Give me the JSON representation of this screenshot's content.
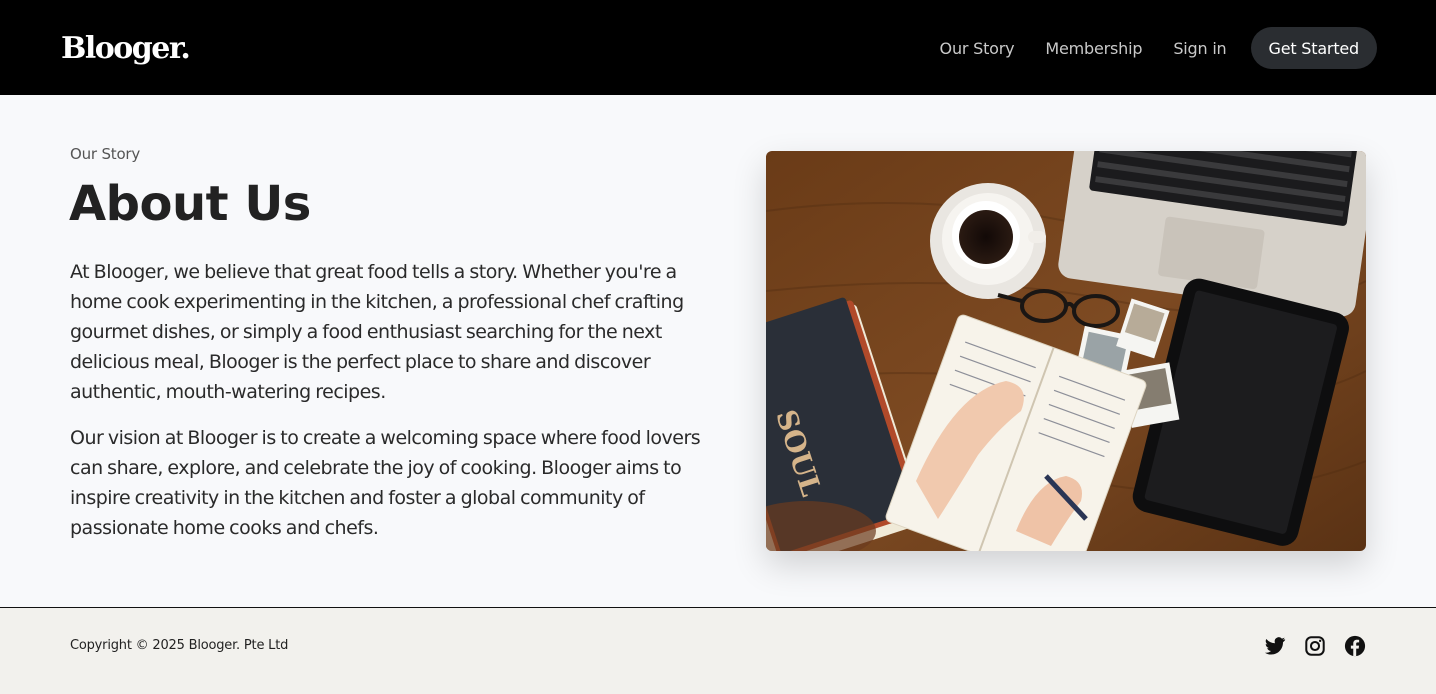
{
  "header": {
    "logo": "Blooger.",
    "nav": [
      "Our Story",
      "Membership",
      "Sign in"
    ],
    "cta": "Get Started"
  },
  "main": {
    "eyebrow": "Our Story",
    "title": "About Us",
    "paragraphs": [
      "At Blooger, we believe that great food tells a story. Whether you're a home cook experimenting in the kitchen, a professional chef crafting gourmet dishes, or simply a food enthusiast searching for the next delicious meal, Blooger is the perfect place to share and discover authentic, mouth-watering recipes.",
      "Our vision at Blooger is to create a welcoming space where food lovers can share, explore, and celebrate the joy of cooking. Blooger aims to inspire creativity in the kitchen and foster a global community of passionate home cooks and chefs."
    ],
    "image": {
      "subject": "desk-with-coffee-laptop-notebook-tablet-photo",
      "book_cover_text": "SOUL"
    }
  },
  "footer": {
    "copyright": "Copyright © 2025 Blooger. Pte Ltd",
    "social_icons": [
      "twitter-icon",
      "instagram-icon",
      "facebook-icon"
    ]
  },
  "colors": {
    "header_bg": "#000000",
    "cta_bg": "#2a2d31",
    "page_bg": "#f8f9fb",
    "footer_bg": "#f2f1ed"
  }
}
